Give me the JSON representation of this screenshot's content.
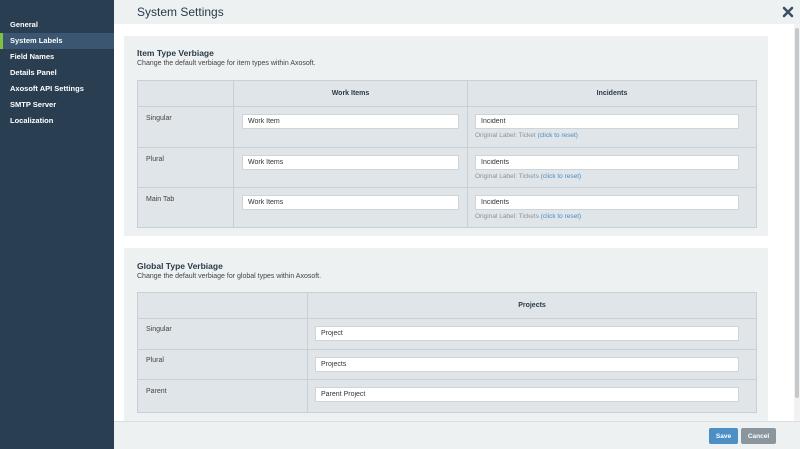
{
  "sidebar": {
    "items": [
      {
        "label": "General"
      },
      {
        "label": "System Labels"
      },
      {
        "label": "Field Names"
      },
      {
        "label": "Details Panel"
      },
      {
        "label": "Axosoft API Settings"
      },
      {
        "label": "SMTP Server"
      },
      {
        "label": "Localization"
      }
    ],
    "active_index": 1
  },
  "header": {
    "title": "System Settings",
    "close_icon": "close-icon"
  },
  "item_type": {
    "title": "Item Type Verbiage",
    "description": "Change the default verbiage for item types within Axosoft.",
    "columns": [
      "Work Items",
      "Incidents"
    ],
    "rows": [
      {
        "label": "Singular",
        "work_items": "Work Item",
        "incidents": "Incident",
        "original": "Original Label: Ticket",
        "reset": "(click to reset)"
      },
      {
        "label": "Plural",
        "work_items": "Work Items",
        "incidents": "Incidents",
        "original": "Original Label: Tickets",
        "reset": "(click to reset)"
      },
      {
        "label": "Main Tab",
        "work_items": "Work Items",
        "incidents": "Incidents",
        "original": "Original Label: Tickets",
        "reset": "(click to reset)"
      }
    ]
  },
  "global_type": {
    "title": "Global Type Verbiage",
    "description": "Change the default verbiage for global types within Axosoft.",
    "columns": [
      "Projects"
    ],
    "rows": [
      {
        "label": "Singular",
        "projects": "Project"
      },
      {
        "label": "Plural",
        "projects": "Projects"
      },
      {
        "label": "Parent",
        "projects": "Parent Project"
      }
    ]
  },
  "footer": {
    "save_label": "Save",
    "cancel_label": "Cancel"
  },
  "colors": {
    "sidebar_bg": "#2a3e52",
    "active_accent": "#7fc241",
    "link": "#4a8cc7",
    "save_btn": "#4d8ec5",
    "cancel_btn": "#8a969e"
  }
}
